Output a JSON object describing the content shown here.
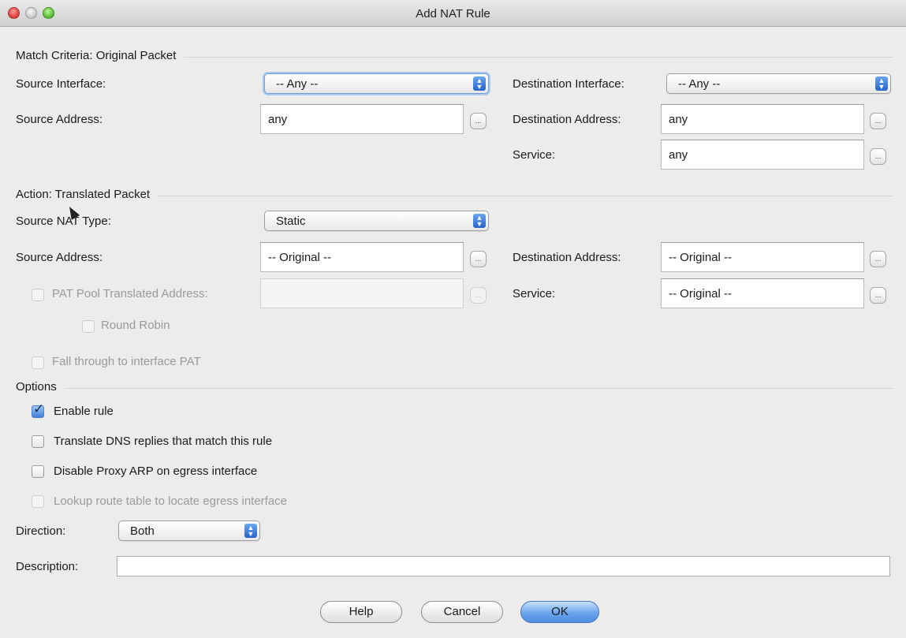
{
  "window": {
    "title": "Add NAT Rule"
  },
  "match": {
    "section_title": "Match Criteria: Original Packet",
    "source_interface_label": "Source Interface:",
    "source_interface_value": "-- Any --",
    "destination_interface_label": "Destination Interface:",
    "destination_interface_value": "-- Any --",
    "source_address_label": "Source Address:",
    "source_address_value": "any",
    "destination_address_label": "Destination Address:",
    "destination_address_value": "any",
    "service_label": "Service:",
    "service_value": "any"
  },
  "action": {
    "section_title": "Action: Translated Packet",
    "source_nat_type_label": "Source NAT Type:",
    "source_nat_type_value": "Static",
    "source_address_label": "Source Address:",
    "source_address_value": "-- Original --",
    "destination_address_label": "Destination Address:",
    "destination_address_value": "-- Original --",
    "pat_pool_label": "PAT Pool Translated Address:",
    "pat_pool_value": "",
    "service_label": "Service:",
    "service_value": "-- Original --",
    "round_robin_label": "Round Robin",
    "fall_through_label": "Fall through to interface PAT"
  },
  "options": {
    "section_title": "Options",
    "enable_rule_label": "Enable rule",
    "enable_rule_checked": true,
    "translate_dns_label": "Translate DNS replies that match this rule",
    "disable_proxy_arp_label": "Disable Proxy ARP on egress interface",
    "lookup_route_label": "Lookup route table to locate egress interface",
    "direction_label": "Direction:",
    "direction_value": "Both",
    "description_label": "Description:",
    "description_value": ""
  },
  "buttons": {
    "help": "Help",
    "cancel": "Cancel",
    "ok": "OK"
  },
  "glyphs": {
    "ellipsis": "...",
    "check": "✓",
    "updown": "▲▼"
  },
  "colors": {
    "accent": "#4d8ee2",
    "window_bg": "#ececec",
    "close": "#e0443e",
    "maximize": "#5fc23c"
  }
}
